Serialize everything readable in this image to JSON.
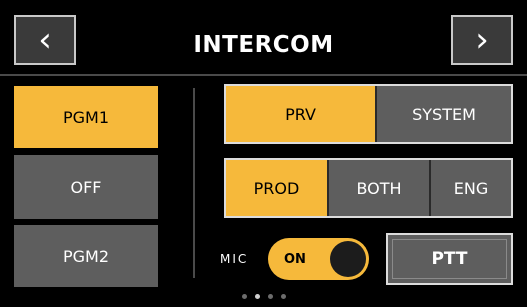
{
  "header": {
    "title": "INTERCOM",
    "back_glyph": "‹",
    "forward_glyph": "›",
    "back_icon": "chevron-left-icon",
    "forward_icon": "chevron-right-icon"
  },
  "channels": [
    {
      "label": "PGM1",
      "active": true
    },
    {
      "label": "OFF",
      "active": false
    },
    {
      "label": "PGM2",
      "active": false
    }
  ],
  "mode_group": [
    {
      "label": "PRV",
      "active": true
    },
    {
      "label": "SYSTEM",
      "active": false
    }
  ],
  "route_group": [
    {
      "label": "PROD",
      "active": true
    },
    {
      "label": "BOTH",
      "active": false
    },
    {
      "label": "ENG",
      "active": false
    }
  ],
  "mic": {
    "label": "MIC",
    "toggle_text": "ON",
    "state": "on"
  },
  "ptt_label": "PTT",
  "pager": {
    "count": 4,
    "active_index": 1
  },
  "colors": {
    "accent": "#f6b93b",
    "inactive": "#5e5e5e",
    "background": "#000000"
  }
}
